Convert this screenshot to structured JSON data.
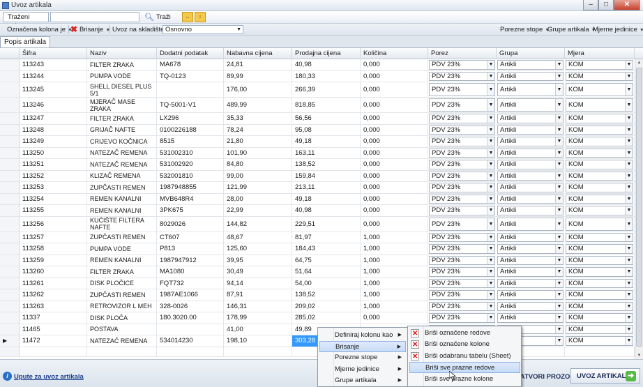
{
  "window": {
    "title": "Uvoz artikala"
  },
  "toolbar1": {
    "search_label": "Traženi pojam",
    "search_button": "Traži",
    "search_value": ""
  },
  "toolbar2": {
    "column_menu": "Označena kolona je",
    "delete_menu": "Brisanje",
    "stock_label": "Uvoz na skladište :",
    "stock_value": "Osnovno",
    "tax_menu": "Porezne stope",
    "groups_menu": "Grupe artikala",
    "units_menu": "Mjerne jedinice"
  },
  "tab": {
    "label": "Popis artikala"
  },
  "columns": [
    "Šifra",
    "Naziv",
    "Dodatni podatak",
    "Nabavna cijena",
    "Prodajna cijena",
    "Količina",
    "Porez",
    "Grupa",
    "Mjera"
  ],
  "rows": [
    [
      "113243",
      "FILTER ZRAKA",
      "MA678",
      "24,81",
      "40,98",
      "0,000",
      "PDV 23%",
      "Artikli",
      "KOM"
    ],
    [
      "113244",
      "PUMPA VODE",
      "TQ-0123",
      "89,99",
      "180,33",
      "0,000",
      "PDV 23%",
      "Artikli",
      "KOM"
    ],
    [
      "113245",
      "SHELL DIESEL PLUS 5/1",
      "",
      "176,00",
      "266,39",
      "0,000",
      "PDV 23%",
      "Artikli",
      "KOM"
    ],
    [
      "113246",
      "MJERAČ MASE ZRAKA",
      "TQ-5001-V1",
      "489,99",
      "818,85",
      "0,000",
      "PDV 23%",
      "Artikli",
      "KOM"
    ],
    [
      "113247",
      "FILTER ZRAKA",
      "LX296",
      "35,33",
      "56,56",
      "0,000",
      "PDV 23%",
      "Artikli",
      "KOM"
    ],
    [
      "113248",
      "GRIJAČ NAFTE",
      "0100226188",
      "78,24",
      "95,08",
      "0,000",
      "PDV 23%",
      "Artikli",
      "KOM"
    ],
    [
      "113249",
      "CRIJEVO KOČNICA",
      "8515",
      "21,80",
      "49,18",
      "0,000",
      "PDV 23%",
      "Artikli",
      "KOM"
    ],
    [
      "113250",
      "NATEZAČ REMENA",
      "531002310",
      "101,90",
      "163,11",
      "0,000",
      "PDV 23%",
      "Artikli",
      "KOM"
    ],
    [
      "113251",
      "NATEZAČ REMENA",
      "531002920",
      "84,80",
      "138,52",
      "0,000",
      "PDV 23%",
      "Artikli",
      "KOM"
    ],
    [
      "113252",
      "KLIZAČ REMENA",
      "532001810",
      "99,00",
      "159,84",
      "0,000",
      "PDV 23%",
      "Artikli",
      "KOM"
    ],
    [
      "113253",
      "ZUPČASTI REMEN",
      "1987948855",
      "121,99",
      "213,11",
      "0,000",
      "PDV 23%",
      "Artikli",
      "KOM"
    ],
    [
      "113254",
      "REMEN KANALNI",
      "MVB648R4",
      "28,00",
      "49,18",
      "0,000",
      "PDV 23%",
      "Artikli",
      "KOM"
    ],
    [
      "113255",
      "REMEN KANALNI",
      "3PK675",
      "22,99",
      "40,98",
      "0,000",
      "PDV 23%",
      "Artikli",
      "KOM"
    ],
    [
      "113256",
      "KUĆIŠTE FILTERA NAFTE",
      "8029026",
      "144,82",
      "229,51",
      "0,000",
      "PDV 23%",
      "Artikli",
      "KOM"
    ],
    [
      "113257",
      "ZUPČASTI REMEN",
      "CT607",
      "48,67",
      "81,97",
      "1,000",
      "PDV 23%",
      "Artikli",
      "KOM"
    ],
    [
      "113258",
      "PUMPA VODE",
      "P813",
      "125,60",
      "184,43",
      "1,000",
      "PDV 23%",
      "Artikli",
      "KOM"
    ],
    [
      "113259",
      "REMEN KANALNI",
      "1987947912",
      "39,95",
      "64,75",
      "1,000",
      "PDV 23%",
      "Artikli",
      "KOM"
    ],
    [
      "113260",
      "FILTER ZRAKA",
      "MA1080",
      "30,49",
      "51,64",
      "1,000",
      "PDV 23%",
      "Artikli",
      "KOM"
    ],
    [
      "113261",
      "DISK PLOČICE",
      "FQT732",
      "94,14",
      "54,00",
      "1,000",
      "PDV 23%",
      "Artikli",
      "KOM"
    ],
    [
      "113262",
      "ZUPČASTI REMEN",
      "1987AE1066",
      "87,91",
      "138,52",
      "1,000",
      "PDV 23%",
      "Artikli",
      "KOM"
    ],
    [
      "113263",
      "RETROVIZOR L MEH",
      "328-0026",
      "146,31",
      "209,02",
      "1,000",
      "PDV 23%",
      "Artikli",
      "KOM"
    ],
    [
      "11337",
      "DISK PLOČA",
      "180.3020.00",
      "178,99",
      "285,02",
      "0,000",
      "PDV 23%",
      "Artikli",
      "KOM"
    ],
    [
      "11465",
      "POSTAVA",
      "",
      "41,00",
      "49,89",
      "",
      "PDV 23%",
      "Artikli",
      "KOM"
    ],
    [
      "11472",
      "NATEZAČ REMENA",
      "534014230",
      "198,10",
      "303,28",
      "",
      "PDV 23%",
      "Artikli",
      "KOM"
    ],
    [
      "",
      "",
      "",
      "",
      "",
      "",
      "",
      "",
      ""
    ]
  ],
  "context_menu": {
    "items": [
      "Definiraj kolonu kao",
      "Brisanje",
      "Porezne stope",
      "Mjerne jedinice",
      "Grupe artikala"
    ],
    "submenu": [
      "Briši označene redove",
      "Briši označene kolone",
      "Briši odabranu tabelu (Sheet)",
      "Briši sve prazne redove",
      "Briši sve prazne kolone"
    ]
  },
  "bottom": {
    "help_link": "Upute za uvoz artikala",
    "close_button": "ZATVORI PROZOR",
    "import_button": "UVOZ ARTIKALA"
  }
}
